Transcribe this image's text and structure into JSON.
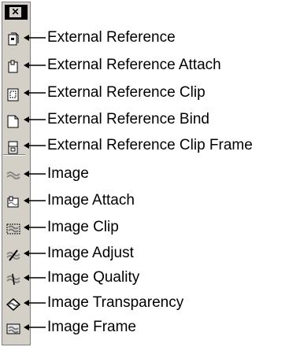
{
  "toolbar": {
    "items": [
      {
        "label": "External Reference",
        "icon": "xref-icon"
      },
      {
        "label": "External Reference Attach",
        "icon": "xref-attach-icon"
      },
      {
        "label": "External Reference Clip",
        "icon": "xref-clip-icon"
      },
      {
        "label": "External Reference Bind",
        "icon": "xref-bind-icon"
      },
      {
        "label": "External Reference Clip Frame",
        "icon": "xref-clip-frame-icon"
      },
      {
        "label": "Image",
        "icon": "image-icon"
      },
      {
        "label": "Image Attach",
        "icon": "image-attach-icon"
      },
      {
        "label": "Image Clip",
        "icon": "image-clip-icon"
      },
      {
        "label": "Image Adjust",
        "icon": "image-adjust-icon"
      },
      {
        "label": "Image Quality",
        "icon": "image-quality-icon"
      },
      {
        "label": "Image Transparency",
        "icon": "image-transparency-icon"
      },
      {
        "label": "Image Frame",
        "icon": "image-frame-icon"
      }
    ]
  }
}
